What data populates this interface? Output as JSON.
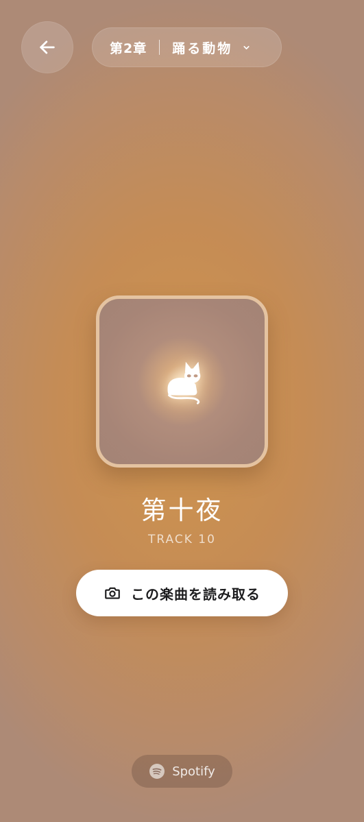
{
  "header": {
    "back_icon": "arrow-left-icon",
    "chapter_label": "第2章",
    "chapter_title": "踊る動物",
    "dropdown_icon": "chevron-down-icon"
  },
  "track": {
    "art_icon": "cat-icon",
    "title": "第十夜",
    "subtitle": "TRACK 10"
  },
  "scan_button": {
    "icon": "camera-icon",
    "label": "この楽曲を読み取る"
  },
  "spotify": {
    "icon": "spotify-icon",
    "label": "Spotify"
  },
  "colors": {
    "background": "#c58c55",
    "art_border": "#e4c3a1",
    "button": "#ffffff"
  }
}
